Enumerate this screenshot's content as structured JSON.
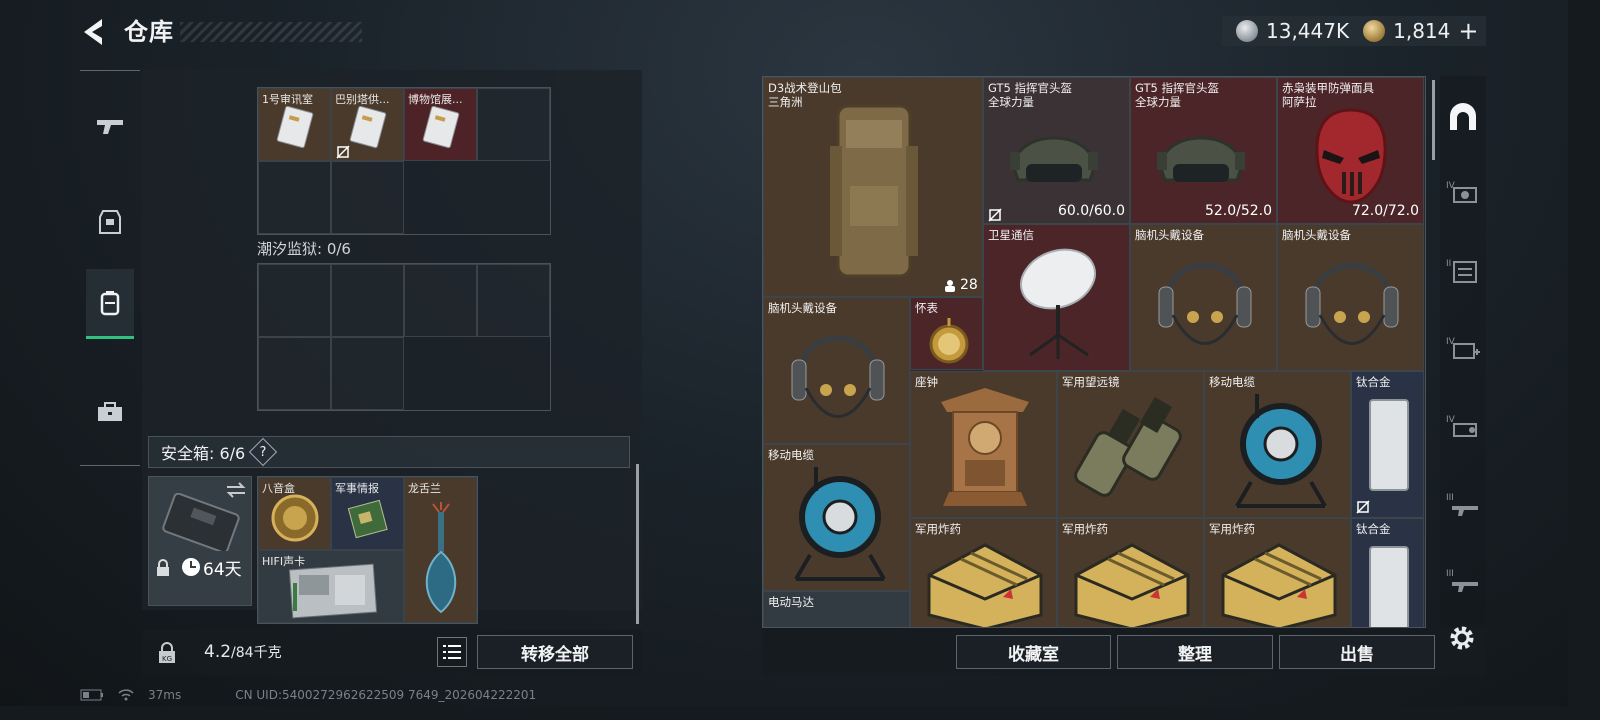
{
  "header": {
    "title": "仓库"
  },
  "currency": {
    "silver": "13,447K",
    "gold": "1,814",
    "gold_add": "+"
  },
  "left": {
    "grid1_cells": [
      {
        "label": "1号审讯室",
        "item": "keycard"
      },
      {
        "label": "巴别塔供...",
        "item": "keycard"
      },
      {
        "label": "博物馆展...",
        "item": "keycard"
      }
    ],
    "prison_label": "潮汐监狱: 0/6",
    "safebox_label": "安全箱: 6/6",
    "help": "?",
    "safebox_days": "64天",
    "safe_items": [
      {
        "label": "八音盒"
      },
      {
        "label": "军事情报"
      },
      {
        "label": "龙舌兰"
      },
      {
        "label": "HIFI声卡"
      }
    ],
    "weight_value": "4.2",
    "weight_total": "/84千克",
    "transfer_all": "转移全部"
  },
  "right": {
    "items": [
      {
        "id": "backpack",
        "label": "D3战术登山包",
        "sub": "三角洲",
        "count": "28"
      },
      {
        "id": "helmet1",
        "label": "GT5 指挥官头盔",
        "sub": "全球力量",
        "durability": "60.0/60.0"
      },
      {
        "id": "helmet2",
        "label": "GT5 指挥官头盔",
        "sub": "全球力量",
        "durability": "52.0/52.0"
      },
      {
        "id": "mask",
        "label": "赤枭装甲防弹面具",
        "sub": "阿萨拉",
        "durability": "72.0/72.0"
      },
      {
        "id": "satellite",
        "label": "卫星通信"
      },
      {
        "id": "headset1",
        "label": "脑机头戴设备"
      },
      {
        "id": "headset2",
        "label": "脑机头戴设备"
      },
      {
        "id": "headset3",
        "label": "脑机头戴设备"
      },
      {
        "id": "watch",
        "label": "怀表"
      },
      {
        "id": "clock",
        "label": "座钟"
      },
      {
        "id": "binoculars",
        "label": "军用望远镜"
      },
      {
        "id": "cable1",
        "label": "移动电缆"
      },
      {
        "id": "titanium1",
        "label": "钛合金"
      },
      {
        "id": "cable2",
        "label": "移动电缆"
      },
      {
        "id": "explosive1",
        "label": "军用炸药"
      },
      {
        "id": "explosive2",
        "label": "军用炸药"
      },
      {
        "id": "explosive3",
        "label": "军用炸药"
      },
      {
        "id": "titanium2",
        "label": "钛合金"
      },
      {
        "id": "motor",
        "label": "电动马达"
      }
    ],
    "buttons": {
      "collection": "收藏室",
      "sort": "整理",
      "sell": "出售"
    }
  },
  "status": {
    "ping": "37ms",
    "uid": "CN UID:5400272962622509 7649_202604222201"
  }
}
